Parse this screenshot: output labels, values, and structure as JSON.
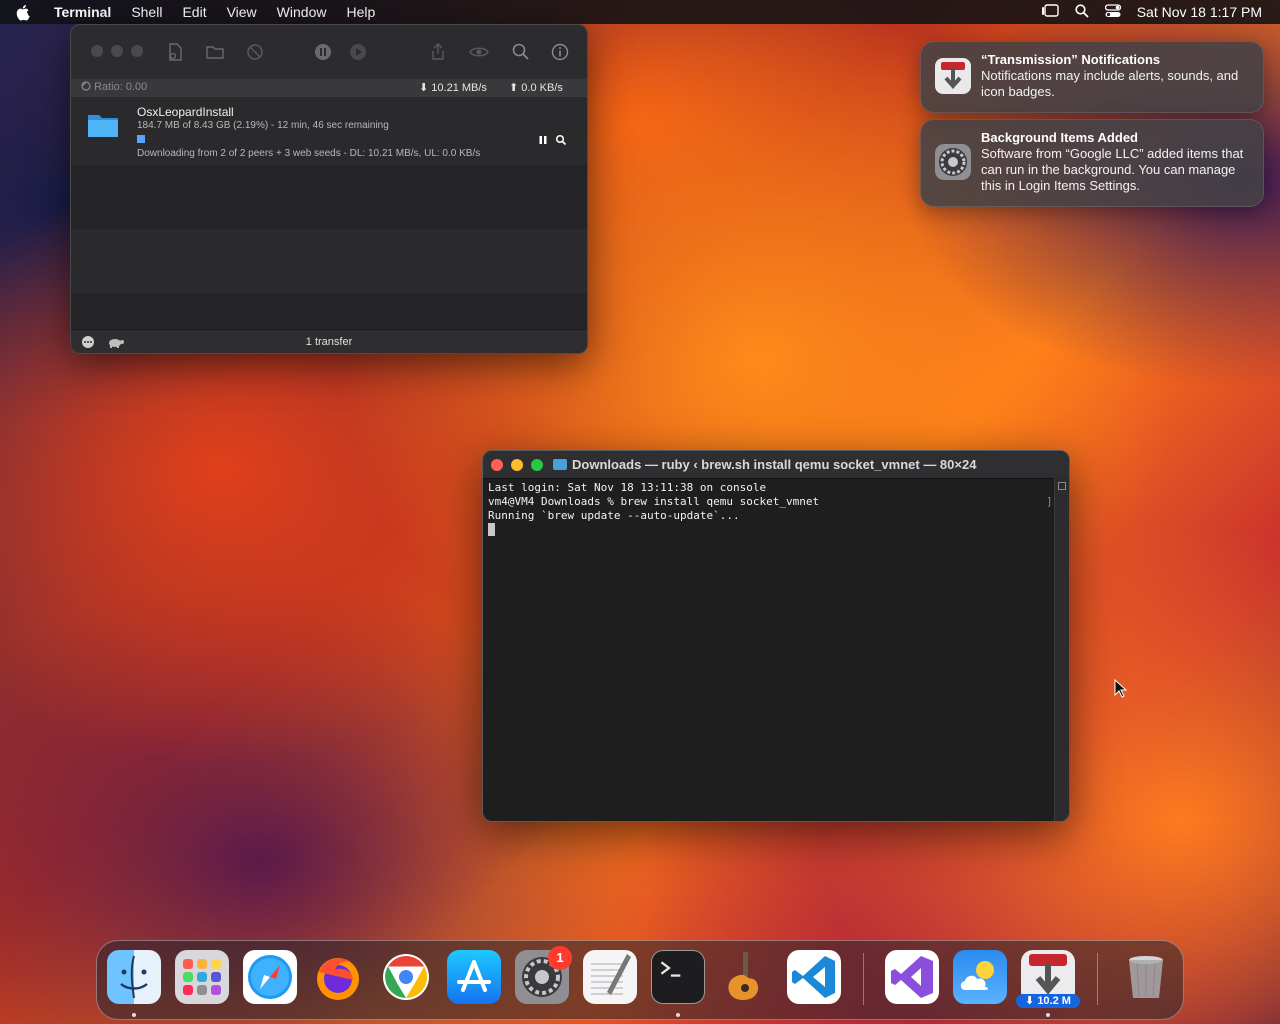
{
  "menubar": {
    "app": "Terminal",
    "items": [
      "Shell",
      "Edit",
      "View",
      "Window",
      "Help"
    ],
    "clock": "Sat Nov 18  1:17 PM"
  },
  "transmission": {
    "ratio": "Ratio: 0.00",
    "download_speed": "10.21 MB/s",
    "upload_speed": "0.0 KB/s",
    "torrent": {
      "name": "OsxLeopardInstall",
      "size_info": "184.7 MB of 8.43 GB (2.19%) - 12 min, 46 sec remaining",
      "progress": 0.0219,
      "peers_info": "Downloading from 2 of 2 peers + 3 web seeds - DL: 10.21 MB/s, UL: 0.0 KB/s"
    },
    "transfer_count": "1 transfer"
  },
  "notifications": [
    {
      "title": "“Transmission” Notifications",
      "body": "Notifications may include alerts, sounds, and icon badges."
    },
    {
      "title": "Background Items Added",
      "body": "Software from “Google LLC” added items that can run in the background. You can manage this in Login Items Settings."
    }
  ],
  "terminal": {
    "title": "Downloads — ruby ‹ brew.sh install qemu socket_vmnet — 80×24",
    "lines": [
      "Last login: Sat Nov 18 13:11:38 on console",
      "vm4@VM4 Downloads % brew install qemu socket_vmnet",
      "Running `brew update --auto-update`..."
    ]
  },
  "dock": {
    "apps": [
      "Finder",
      "Launchpad",
      "Safari",
      "Firefox",
      "Google Chrome",
      "App Store",
      "System Settings",
      "TextEdit",
      "Terminal",
      "GarageBand",
      "Visual Studio Code",
      "Visual Studio",
      "Weather",
      "Transmission",
      "Trash"
    ],
    "settings_badge": "1",
    "transmission_badge": "10.2 M"
  },
  "colors": {
    "accent_blue": "#1665e0",
    "badge_red": "#ff3b30",
    "progress_blue": "#5aa3ff"
  }
}
